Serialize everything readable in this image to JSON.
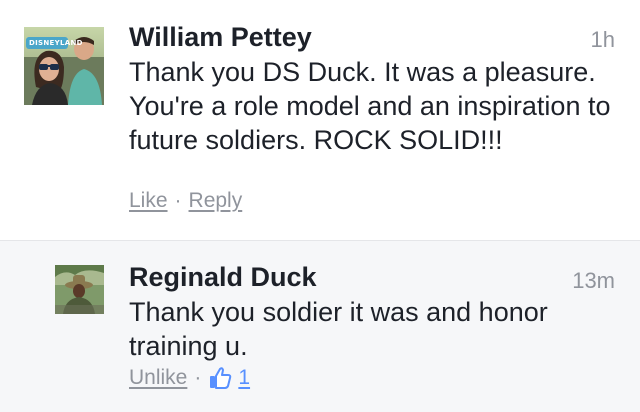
{
  "comments": [
    {
      "author": "William Pettey",
      "time": "1h",
      "text": "Thank you DS Duck. It was a pleasure. You're a role model and an inspiration to future soldiers. ROCK SOLID!!!",
      "avatar_sign_text": "DISNEYLAND",
      "actions": {
        "like": "Like",
        "separator": "·",
        "reply": "Reply"
      }
    },
    {
      "author": "Reginald Duck",
      "time": "13m",
      "text": "Thank you soldier it was and honor training u.",
      "actions": {
        "unlike": "Unlike",
        "separator": "·",
        "like_count": "1",
        "like_icon": "thumbs-up-icon"
      }
    }
  ],
  "colors": {
    "meta_gray": "#90949c",
    "text_dark": "#1d2129",
    "reply_bg": "#f6f7f9",
    "like_blue": "#5890ff"
  }
}
